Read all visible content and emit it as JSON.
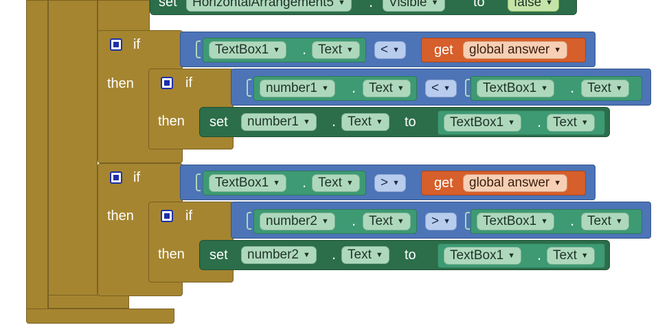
{
  "top_partial": {
    "set": "set",
    "component": "HorizontalArrangement5",
    "dot": ".",
    "property": "Visible",
    "to": "to",
    "value": "false"
  },
  "blocks": [
    {
      "if": "if",
      "then": "then",
      "cond_component": "TextBox1",
      "cond_dot": ".",
      "cond_property": "Text",
      "cond_op": "<",
      "get": "get",
      "variable": "global answer",
      "inner_if": "if",
      "inner_then": "then",
      "inner_left_component": "number1",
      "inner_left_dot": ".",
      "inner_left_property": "Text",
      "inner_op": "<",
      "inner_right_component": "TextBox1",
      "inner_right_dot": ".",
      "inner_right_property": "Text",
      "set": "set",
      "set_component": "number1",
      "set_dot": ".",
      "set_property": "Text",
      "to": "to",
      "val_component": "TextBox1",
      "val_dot": ".",
      "val_property": "Text"
    },
    {
      "if": "if",
      "then": "then",
      "cond_component": "TextBox1",
      "cond_dot": ".",
      "cond_property": "Text",
      "cond_op": ">",
      "get": "get",
      "variable": "global answer",
      "inner_if": "if",
      "inner_then": "then",
      "inner_left_component": "number2",
      "inner_left_dot": ".",
      "inner_left_property": "Text",
      "inner_op": ">",
      "inner_right_component": "TextBox1",
      "inner_right_dot": ".",
      "inner_right_property": "Text",
      "set": "set",
      "set_component": "number2",
      "set_dot": ".",
      "set_property": "Text",
      "to": "to",
      "val_component": "TextBox1",
      "val_dot": ".",
      "val_property": "Text"
    }
  ],
  "colors": {
    "control": "#a58530",
    "logic": "#4c74b7",
    "component": "#3d9a73",
    "setter": "#2c6e49",
    "variable": "#d65f2b"
  }
}
